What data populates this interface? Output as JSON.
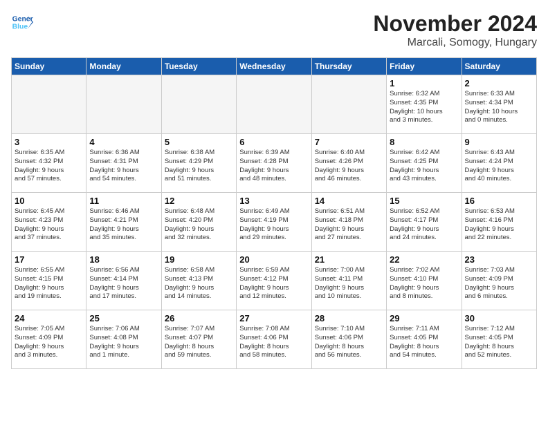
{
  "header": {
    "logo_line1": "General",
    "logo_line2": "Blue",
    "month": "November 2024",
    "location": "Marcali, Somogy, Hungary"
  },
  "weekdays": [
    "Sunday",
    "Monday",
    "Tuesday",
    "Wednesday",
    "Thursday",
    "Friday",
    "Saturday"
  ],
  "weeks": [
    [
      {
        "day": "",
        "info": ""
      },
      {
        "day": "",
        "info": ""
      },
      {
        "day": "",
        "info": ""
      },
      {
        "day": "",
        "info": ""
      },
      {
        "day": "",
        "info": ""
      },
      {
        "day": "1",
        "info": "Sunrise: 6:32 AM\nSunset: 4:35 PM\nDaylight: 10 hours\nand 3 minutes."
      },
      {
        "day": "2",
        "info": "Sunrise: 6:33 AM\nSunset: 4:34 PM\nDaylight: 10 hours\nand 0 minutes."
      }
    ],
    [
      {
        "day": "3",
        "info": "Sunrise: 6:35 AM\nSunset: 4:32 PM\nDaylight: 9 hours\nand 57 minutes."
      },
      {
        "day": "4",
        "info": "Sunrise: 6:36 AM\nSunset: 4:31 PM\nDaylight: 9 hours\nand 54 minutes."
      },
      {
        "day": "5",
        "info": "Sunrise: 6:38 AM\nSunset: 4:29 PM\nDaylight: 9 hours\nand 51 minutes."
      },
      {
        "day": "6",
        "info": "Sunrise: 6:39 AM\nSunset: 4:28 PM\nDaylight: 9 hours\nand 48 minutes."
      },
      {
        "day": "7",
        "info": "Sunrise: 6:40 AM\nSunset: 4:26 PM\nDaylight: 9 hours\nand 46 minutes."
      },
      {
        "day": "8",
        "info": "Sunrise: 6:42 AM\nSunset: 4:25 PM\nDaylight: 9 hours\nand 43 minutes."
      },
      {
        "day": "9",
        "info": "Sunrise: 6:43 AM\nSunset: 4:24 PM\nDaylight: 9 hours\nand 40 minutes."
      }
    ],
    [
      {
        "day": "10",
        "info": "Sunrise: 6:45 AM\nSunset: 4:23 PM\nDaylight: 9 hours\nand 37 minutes."
      },
      {
        "day": "11",
        "info": "Sunrise: 6:46 AM\nSunset: 4:21 PM\nDaylight: 9 hours\nand 35 minutes."
      },
      {
        "day": "12",
        "info": "Sunrise: 6:48 AM\nSunset: 4:20 PM\nDaylight: 9 hours\nand 32 minutes."
      },
      {
        "day": "13",
        "info": "Sunrise: 6:49 AM\nSunset: 4:19 PM\nDaylight: 9 hours\nand 29 minutes."
      },
      {
        "day": "14",
        "info": "Sunrise: 6:51 AM\nSunset: 4:18 PM\nDaylight: 9 hours\nand 27 minutes."
      },
      {
        "day": "15",
        "info": "Sunrise: 6:52 AM\nSunset: 4:17 PM\nDaylight: 9 hours\nand 24 minutes."
      },
      {
        "day": "16",
        "info": "Sunrise: 6:53 AM\nSunset: 4:16 PM\nDaylight: 9 hours\nand 22 minutes."
      }
    ],
    [
      {
        "day": "17",
        "info": "Sunrise: 6:55 AM\nSunset: 4:15 PM\nDaylight: 9 hours\nand 19 minutes."
      },
      {
        "day": "18",
        "info": "Sunrise: 6:56 AM\nSunset: 4:14 PM\nDaylight: 9 hours\nand 17 minutes."
      },
      {
        "day": "19",
        "info": "Sunrise: 6:58 AM\nSunset: 4:13 PM\nDaylight: 9 hours\nand 14 minutes."
      },
      {
        "day": "20",
        "info": "Sunrise: 6:59 AM\nSunset: 4:12 PM\nDaylight: 9 hours\nand 12 minutes."
      },
      {
        "day": "21",
        "info": "Sunrise: 7:00 AM\nSunset: 4:11 PM\nDaylight: 9 hours\nand 10 minutes."
      },
      {
        "day": "22",
        "info": "Sunrise: 7:02 AM\nSunset: 4:10 PM\nDaylight: 9 hours\nand 8 minutes."
      },
      {
        "day": "23",
        "info": "Sunrise: 7:03 AM\nSunset: 4:09 PM\nDaylight: 9 hours\nand 6 minutes."
      }
    ],
    [
      {
        "day": "24",
        "info": "Sunrise: 7:05 AM\nSunset: 4:09 PM\nDaylight: 9 hours\nand 3 minutes."
      },
      {
        "day": "25",
        "info": "Sunrise: 7:06 AM\nSunset: 4:08 PM\nDaylight: 9 hours\nand 1 minute."
      },
      {
        "day": "26",
        "info": "Sunrise: 7:07 AM\nSunset: 4:07 PM\nDaylight: 8 hours\nand 59 minutes."
      },
      {
        "day": "27",
        "info": "Sunrise: 7:08 AM\nSunset: 4:06 PM\nDaylight: 8 hours\nand 58 minutes."
      },
      {
        "day": "28",
        "info": "Sunrise: 7:10 AM\nSunset: 4:06 PM\nDaylight: 8 hours\nand 56 minutes."
      },
      {
        "day": "29",
        "info": "Sunrise: 7:11 AM\nSunset: 4:05 PM\nDaylight: 8 hours\nand 54 minutes."
      },
      {
        "day": "30",
        "info": "Sunrise: 7:12 AM\nSunset: 4:05 PM\nDaylight: 8 hours\nand 52 minutes."
      }
    ]
  ]
}
